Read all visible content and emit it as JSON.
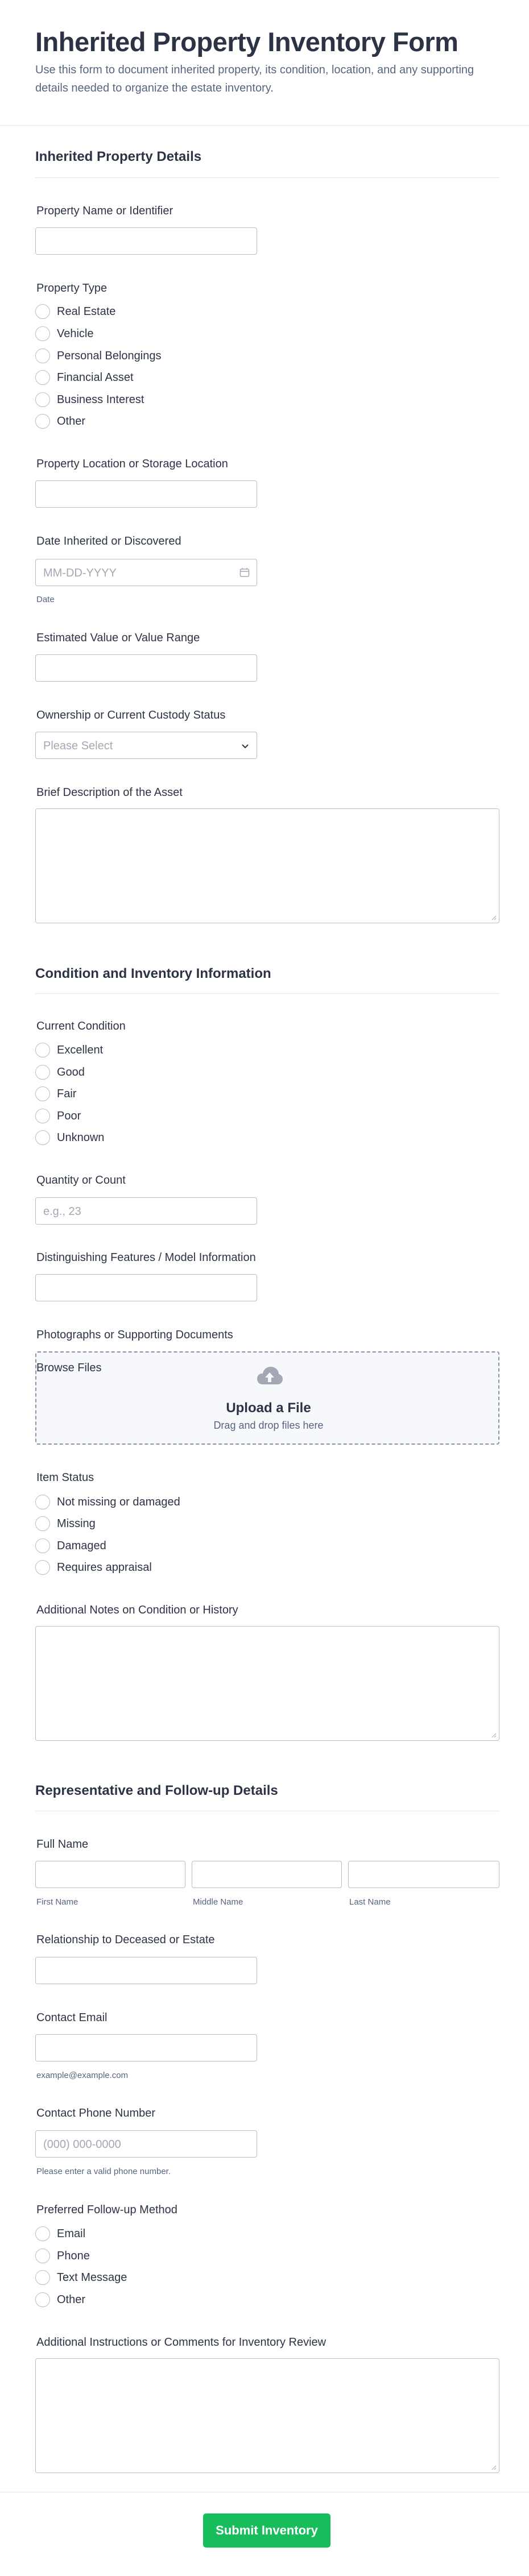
{
  "header": {
    "title": "Inherited Property Inventory Form",
    "subtitle": "Use this form to document inherited property, its condition, location, and any supporting details needed to organize the estate inventory."
  },
  "section1": {
    "title": "Inherited Property Details",
    "property_name_label": "Property Name or Identifier",
    "property_type_label": "Property Type",
    "property_type_options": [
      "Real Estate",
      "Vehicle",
      "Personal Belongings",
      "Financial Asset",
      "Business Interest",
      "Other"
    ],
    "location_label": "Property Location or Storage Location",
    "date_label": "Date Inherited or Discovered",
    "date_placeholder": "MM-DD-YYYY",
    "date_sublabel": "Date",
    "value_label": "Estimated Value or Value Range",
    "ownership_label": "Ownership or Current Custody Status",
    "ownership_placeholder": "Please Select",
    "description_label": "Brief Description of the Asset"
  },
  "section2": {
    "title": "Condition and Inventory Information",
    "condition_label": "Current Condition",
    "condition_options": [
      "Excellent",
      "Good",
      "Fair",
      "Poor",
      "Unknown"
    ],
    "quantity_label": "Quantity or Count",
    "quantity_placeholder": "e.g., 23",
    "features_label": "Distinguishing Features / Model Information",
    "photos_label": "Photographs or Supporting Documents",
    "browse_label": "Browse Files",
    "upload_title": "Upload a File",
    "upload_sub": "Drag and drop files here",
    "status_label": "Item Status",
    "status_options": [
      "Not missing or damaged",
      "Missing",
      "Damaged",
      "Requires appraisal"
    ],
    "notes_label": "Additional Notes on Condition or History"
  },
  "section3": {
    "title": "Representative and Follow-up Details",
    "fullname_label": "Full Name",
    "first_name": "First Name",
    "middle_name": "Middle Name",
    "last_name": "Last Name",
    "relationship_label": "Relationship to Deceased or Estate",
    "email_label": "Contact Email",
    "email_sublabel": "example@example.com",
    "phone_label": "Contact Phone Number",
    "phone_placeholder": "(000) 000-0000",
    "phone_sublabel": "Please enter a valid phone number.",
    "followup_label": "Preferred Follow-up Method",
    "followup_options": [
      "Email",
      "Phone",
      "Text Message",
      "Other"
    ],
    "instructions_label": "Additional Instructions or Comments for Inventory Review"
  },
  "footer": {
    "submit_label": "Submit Inventory"
  },
  "colors": {
    "submit": "#18bd5b",
    "text": "#2c3345",
    "muted": "#57647e",
    "border": "#b8bdc9"
  }
}
